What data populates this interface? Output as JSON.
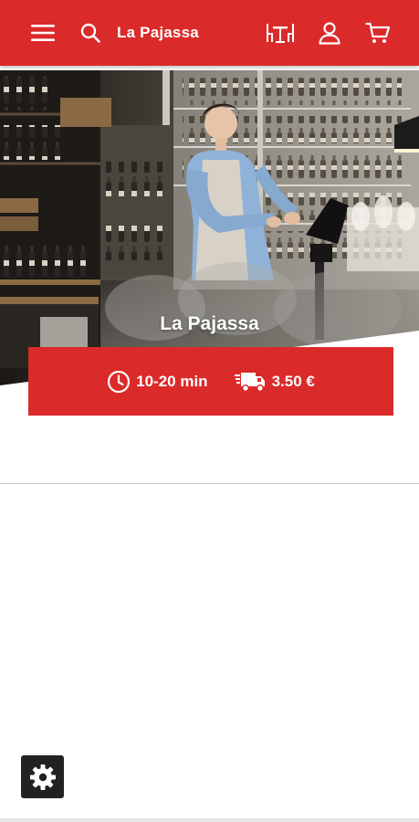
{
  "colors": {
    "brand": "#db2a2a",
    "text_on_brand": "#ffffff",
    "settings_button": "#222222"
  },
  "header": {
    "title": "La Pajassa",
    "icons": [
      "menu-icon",
      "search-icon",
      "restaurant-table-icon",
      "user-icon",
      "cart-icon"
    ]
  },
  "hero": {
    "restaurant_name": "La Pajassa",
    "delivery_time": "10-20 min",
    "delivery_fee": "3.50 €",
    "icons": [
      "clock-icon",
      "delivery-truck-icon"
    ]
  },
  "footer": {
    "icons": [
      "gear-icon"
    ]
  }
}
